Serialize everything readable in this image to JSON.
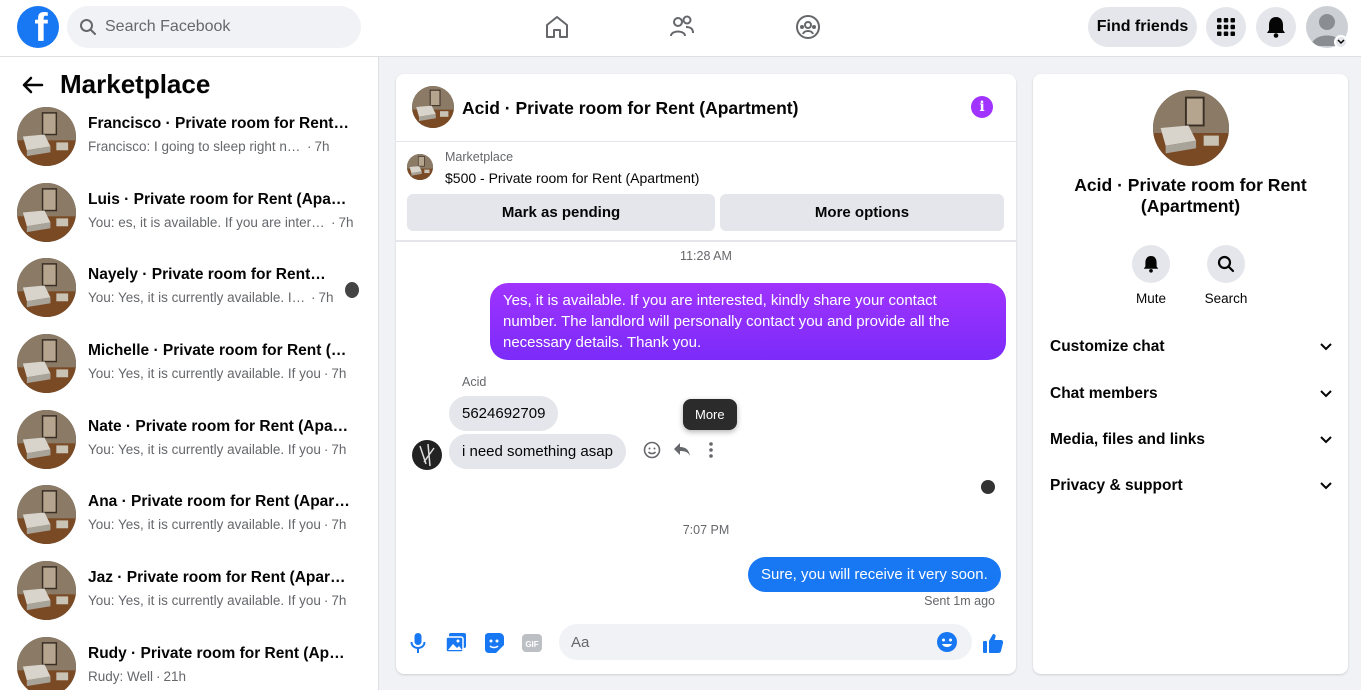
{
  "colors": {
    "brand": "#1877f2",
    "accent": "#a033ff",
    "outgoing_bubble": "#7b2bf9",
    "incoming_bubble": "#e4e6eb"
  },
  "header": {
    "logo_letter": "f",
    "search_placeholder": "Search Facebook",
    "nav_icons": [
      "home-icon",
      "friends-icon",
      "groups-icon"
    ],
    "find_friends_label": "Find friends",
    "right_icons": [
      "menu-grid-icon",
      "notifications-bell-icon",
      "profile-avatar",
      "chevron-down-icon"
    ]
  },
  "sidebar": {
    "title": "Marketplace",
    "conversations": [
      {
        "title": "Francisco · Private room for Rent (Apartment)",
        "preview": "Francisco: I going to sleep right now",
        "time": "7h"
      },
      {
        "title": "Luis · Private room for Rent (Apartment)",
        "preview": "You: es, it is available. If you are interested",
        "time": "7h"
      },
      {
        "title": "Nayely · Private room for Rent (Apartment)",
        "preview": "You: Yes, it is currently available. If you",
        "time": "7h"
      },
      {
        "title": "Michelle · Private room for Rent (Apartment)",
        "preview": "You: Yes, it is currently available. If you",
        "time": "7h"
      },
      {
        "title": "Nate · Private room for Rent (Apartment)",
        "preview": "You: Yes, it is currently available. If you",
        "time": "7h"
      },
      {
        "title": "Ana · Private room for Rent (Apartment)",
        "preview": "You: Yes, it is currently available. If you",
        "time": "7h"
      },
      {
        "title": "Jaz · Private room for Rent (Apartment)",
        "preview": "You: Yes, it is currently available. If you",
        "time": "7h"
      },
      {
        "title": "Rudy · Private room for Rent (Apartment)",
        "preview": "Rudy: Well",
        "time": "21h"
      }
    ]
  },
  "chat": {
    "title": "Acid · Private room for Rent (Apartment)",
    "marketplace_label": "Marketplace",
    "listing": "$500 - Private room for Rent (Apartment)",
    "mark_pending_label": "Mark as pending",
    "more_options_label": "More options",
    "time_1": "11:28 AM",
    "outgoing_message": "Yes, it is available. If you are interested, kindly share your contact number. The landlord will personally contact you and provide all the necessary details. Thank you.",
    "sender_name": "Acid",
    "incoming_1": "5624692709",
    "incoming_2": "i need something asap",
    "tooltip": "More",
    "time_2": "7:07 PM",
    "reply_message": "Sure, you will receive it very soon.",
    "sent_status": "Sent 1m ago",
    "composer_placeholder": "Aa",
    "composer_icons": [
      "microphone-icon",
      "photo-icon",
      "sticker-icon",
      "gif-icon",
      "emoji-icon",
      "like-icon"
    ]
  },
  "details": {
    "title": "Acid · Private room for Rent (Apartment)",
    "mute_label": "Mute",
    "search_label": "Search",
    "sections": [
      "Customize chat",
      "Chat members",
      "Media, files and links",
      "Privacy & support"
    ]
  }
}
